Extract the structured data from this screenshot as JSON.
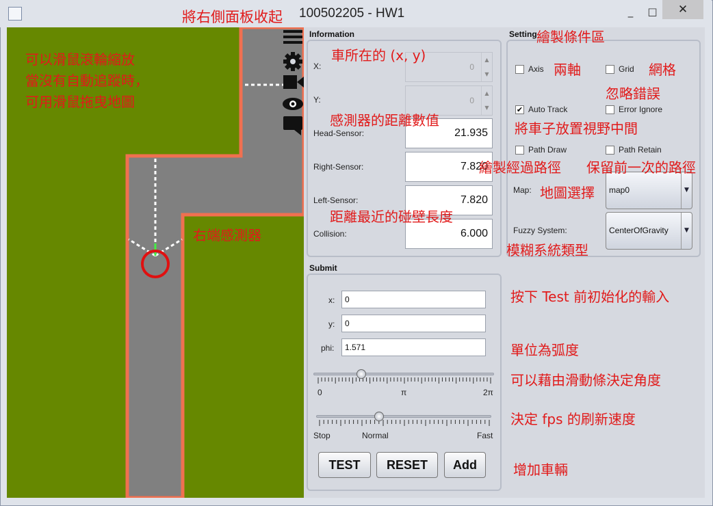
{
  "window": {
    "title": "100502205 - HW1",
    "minimize": "_",
    "maximize": "□",
    "close": "✕"
  },
  "map": {
    "colors": {
      "grass": "#668800",
      "road": "#808080",
      "wall": "#f07050",
      "car": "#e01010"
    },
    "toolbar_icons": [
      "menu-icon",
      "gear-icon",
      "video-icon",
      "eye-icon",
      "comment-icon"
    ]
  },
  "information": {
    "title": "Information",
    "x_label": "X:",
    "x_value": "0",
    "y_label": "Y:",
    "y_value": "0",
    "head_label": "Head-Sensor:",
    "head_value": "21.935",
    "right_label": "Right-Sensor:",
    "right_value": "7.820",
    "left_label": "Left-Sensor:",
    "left_value": "7.820",
    "collision_label": "Collision:",
    "collision_value": "6.000"
  },
  "setting": {
    "title": "Setting",
    "axis": {
      "label": "Axis",
      "checked": false
    },
    "grid": {
      "label": "Grid",
      "checked": false
    },
    "auto_track": {
      "label": "Auto Track",
      "checked": true
    },
    "error_ignore": {
      "label": "Error Ignore",
      "checked": false
    },
    "path_draw": {
      "label": "Path Draw",
      "checked": false
    },
    "path_retain": {
      "label": "Path Retain",
      "checked": false
    },
    "map_label": "Map:",
    "map_value": "map0",
    "fuzzy_label": "Fuzzy System:",
    "fuzzy_value": "CenterOfGravity",
    "check_mark": "✔",
    "combo_arrow": "▼"
  },
  "submit": {
    "title": "Submit",
    "x_label": "x:",
    "x_value": "0",
    "y_label": "y:",
    "y_value": "0",
    "phi_label": "phi:",
    "phi_value": "1.571",
    "angle_min": "0",
    "angle_mid": "π",
    "angle_max": "2π",
    "angle_slider_fraction": 0.25,
    "speed_min": "Stop",
    "speed_mid": "Normal",
    "speed_max": "Fast",
    "speed_slider_fraction": 0.35,
    "test_label": "TEST",
    "reset_label": "RESET",
    "add_label": "Add"
  },
  "annotations": {
    "collapse_panel": "將右側面板收起",
    "zoom_1": "可以滑鼠滾輪縮放",
    "zoom_2": "當沒有自動追蹤時，",
    "zoom_3": "可用滑鼠拖曳地圖",
    "right_sensor": "右端感測器",
    "car_position": "車所在的 (x, y)",
    "sensor_distance": "感測器的距離數值",
    "nearest_wall": "距離最近的碰壁長度",
    "draw_conditions": "繪製條件區",
    "axis_note": "兩軸",
    "grid_note": "網格",
    "error_note": "忽略錯誤",
    "track_note": "將車子放置視野中間",
    "path_note": "繪製經過路徑",
    "retain_note": "保留前一次的路徑",
    "map_note": "地圖選擇",
    "fuzzy_note": "模糊系統類型",
    "init_note": "按下 Test 前初始化的輸入",
    "radian_note": "單位為弧度",
    "angle_note": "可以藉由滑動條決定角度",
    "fps_note": "決定 fps 的刷新速度",
    "add_note": "增加車輛"
  }
}
